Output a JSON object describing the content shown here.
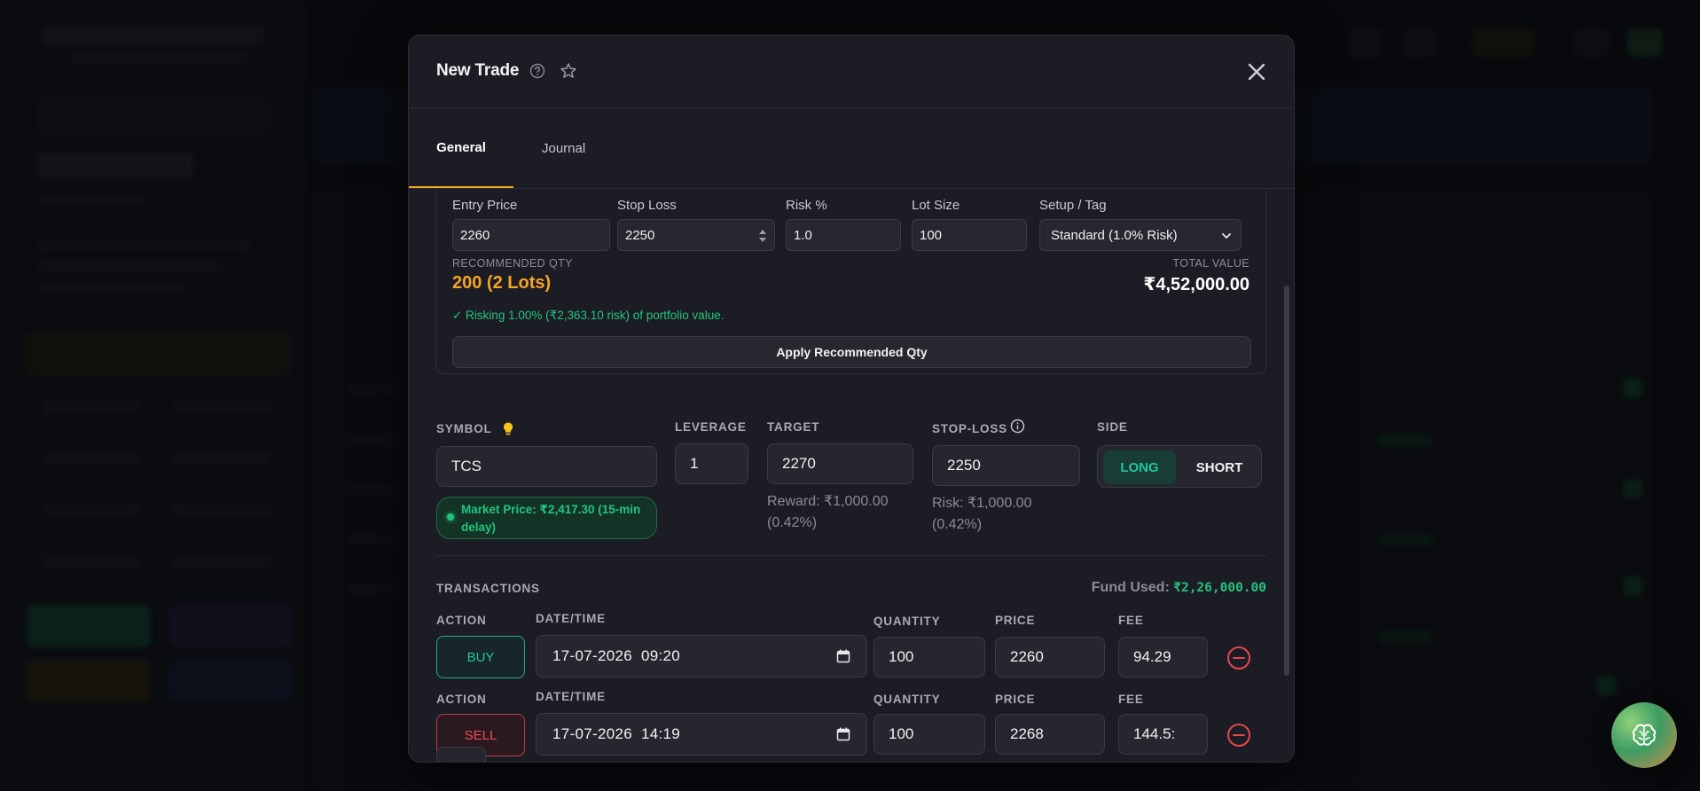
{
  "modal": {
    "title": "New Trade",
    "tabs": [
      {
        "label": "General"
      },
      {
        "label": "Journal"
      }
    ]
  },
  "risk_calc": {
    "entry_price_label": "Entry Price",
    "entry_price_value": "2260",
    "stop_loss_label": "Stop Loss",
    "stop_loss_value": "2250",
    "risk_label": "Risk %",
    "risk_value": "1.0",
    "lot_size_label": "Lot Size",
    "lot_size_value": "100",
    "setup_label": "Setup / Tag",
    "setup_value": "Standard (1.0% Risk)",
    "recommended_qty_label": "RECOMMENDED QTY",
    "recommended_qty_value": "200 (2 Lots)",
    "total_value_label": "TOTAL VALUE",
    "total_value_value": "₹4,52,000.00",
    "risk_note": "✓ Risking 1.00% (₹2,363.10 risk) of portfolio value.",
    "apply_button": "Apply Recommended Qty"
  },
  "trade": {
    "symbol_label": "SYMBOL",
    "symbol_value": "TCS",
    "market_price": "Market Price: ₹2,417.30 (15-min delay)",
    "leverage_label": "LEVERAGE",
    "leverage_value": "1",
    "target_label": "TARGET",
    "target_value": "2270",
    "reward_text": "Reward: ₹1,000.00 (0.42%)",
    "stoploss_label": "STOP-LOSS",
    "stoploss_value": "2250",
    "risk_text": "Risk: ₹1,000.00 (0.42%)",
    "side_label": "SIDE",
    "side_long": "LONG",
    "side_short": "SHORT",
    "selected_side": "LONG"
  },
  "transactions": {
    "label": "TRANSACTIONS",
    "fund_used_label": "Fund Used:",
    "fund_used_value": "₹2,26,000.00",
    "col_action": "ACTION",
    "col_datetime": "DATE/TIME",
    "col_quantity": "QUANTITY",
    "col_price": "PRICE",
    "col_fee": "FEE",
    "rows": [
      {
        "action": "BUY",
        "datetime": "17-07-2026  09:20",
        "quantity": "100",
        "price": "2260",
        "fee": "94.29"
      },
      {
        "action": "SELL",
        "datetime": "17-07-2026  14:19",
        "quantity": "100",
        "price": "2268",
        "fee": "144.5:"
      }
    ]
  },
  "colors": {
    "accent": "#f5a524",
    "positive": "#22c57e",
    "negative": "#ef4a5a",
    "modal_bg": "#1c1c24"
  },
  "icons": [
    "help-icon",
    "star-icon",
    "close-icon",
    "spinner-icon",
    "chevron-down-icon",
    "bulb-icon",
    "info-icon",
    "calendar-icon",
    "minus-circle-icon",
    "brain-icon"
  ]
}
